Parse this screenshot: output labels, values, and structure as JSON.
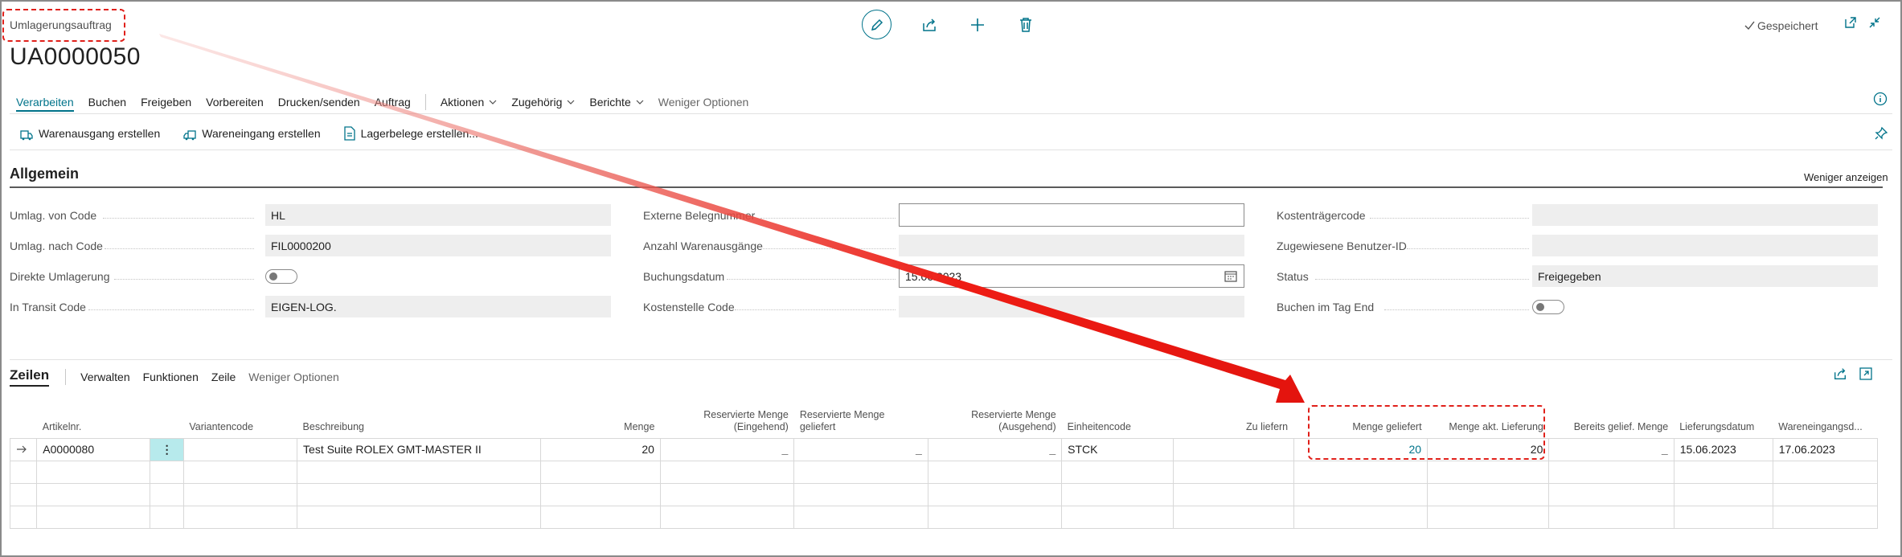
{
  "header": {
    "caption": "Umlagerungsauftrag",
    "doc_no": "UA0000050",
    "saved": "Gespeichert"
  },
  "menu": {
    "items": [
      "Verarbeiten",
      "Buchen",
      "Freigeben",
      "Vorbereiten",
      "Drucken/senden",
      "Auftrag"
    ],
    "dropdowns": [
      "Aktionen",
      "Zugehörig",
      "Berichte"
    ],
    "less": "Weniger Optionen"
  },
  "actions": {
    "a1": "Warenausgang erstellen",
    "a2": "Wareneingang erstellen",
    "a3": "Lagerbelege erstellen..."
  },
  "general": {
    "title": "Allgemein",
    "show_less": "Weniger anzeigen",
    "col1": [
      {
        "label": "Umlag. von Code",
        "value": "HL"
      },
      {
        "label": "Umlag. nach Code",
        "value": "FIL0000200"
      },
      {
        "label": "Direkte Umlagerung",
        "value": ""
      },
      {
        "label": "In Transit Code",
        "value": "EIGEN-LOG."
      }
    ],
    "col2": [
      {
        "label": "Externe Belegnummer",
        "value": ""
      },
      {
        "label": "Anzahl Warenausgänge",
        "value": ""
      },
      {
        "label": "Buchungsdatum",
        "value": "15.06.2023"
      },
      {
        "label": "Kostenstelle Code",
        "value": ""
      }
    ],
    "col3": [
      {
        "label": "Kostenträgercode",
        "value": ""
      },
      {
        "label": "Zugewiesene Benutzer-ID",
        "value": ""
      },
      {
        "label": "Status",
        "value": "Freigegeben"
      },
      {
        "label": "Buchen im Tag End",
        "value": ""
      }
    ]
  },
  "lines": {
    "title": "Zeilen",
    "items": [
      "Verwalten",
      "Funktionen",
      "Zeile"
    ],
    "less": "Weniger Optionen",
    "columns": {
      "artikel": "Artikelnr.",
      "variante": "Variantencode",
      "beschreibung": "Beschreibung",
      "menge": "Menge",
      "res_ein_1": "Reservierte Menge",
      "res_ein_2": "(Eingehend)",
      "res_gel": "Reservierte Menge geliefert",
      "res_aus_1": "Reservierte Menge",
      "res_aus_2": "(Ausgehend)",
      "einheit": "Einheitencode",
      "zu_liefern": "Zu liefern",
      "geliefert": "Menge geliefert",
      "akt": "Menge akt. Lieferung",
      "bereits": "Bereits gelief. Menge",
      "lieferdatum": "Lieferungsdatum",
      "wareneingang": "Wareneingangsd..."
    },
    "row": {
      "artikel": "A0000080",
      "beschreibung": "Test Suite ROLEX GMT-MASTER II",
      "menge": "20",
      "res_ein": "_",
      "res_gel": "_",
      "res_aus": "_",
      "einheit": "STCK",
      "geliefert": "20",
      "akt": "20",
      "bereits": "_",
      "lieferdatum": "15.06.2023",
      "wareneingang": "17.06.2023"
    }
  },
  "colors": {
    "accent": "#00738a",
    "highlight": "#e0201a",
    "selected_cell": "#b7eaec"
  }
}
